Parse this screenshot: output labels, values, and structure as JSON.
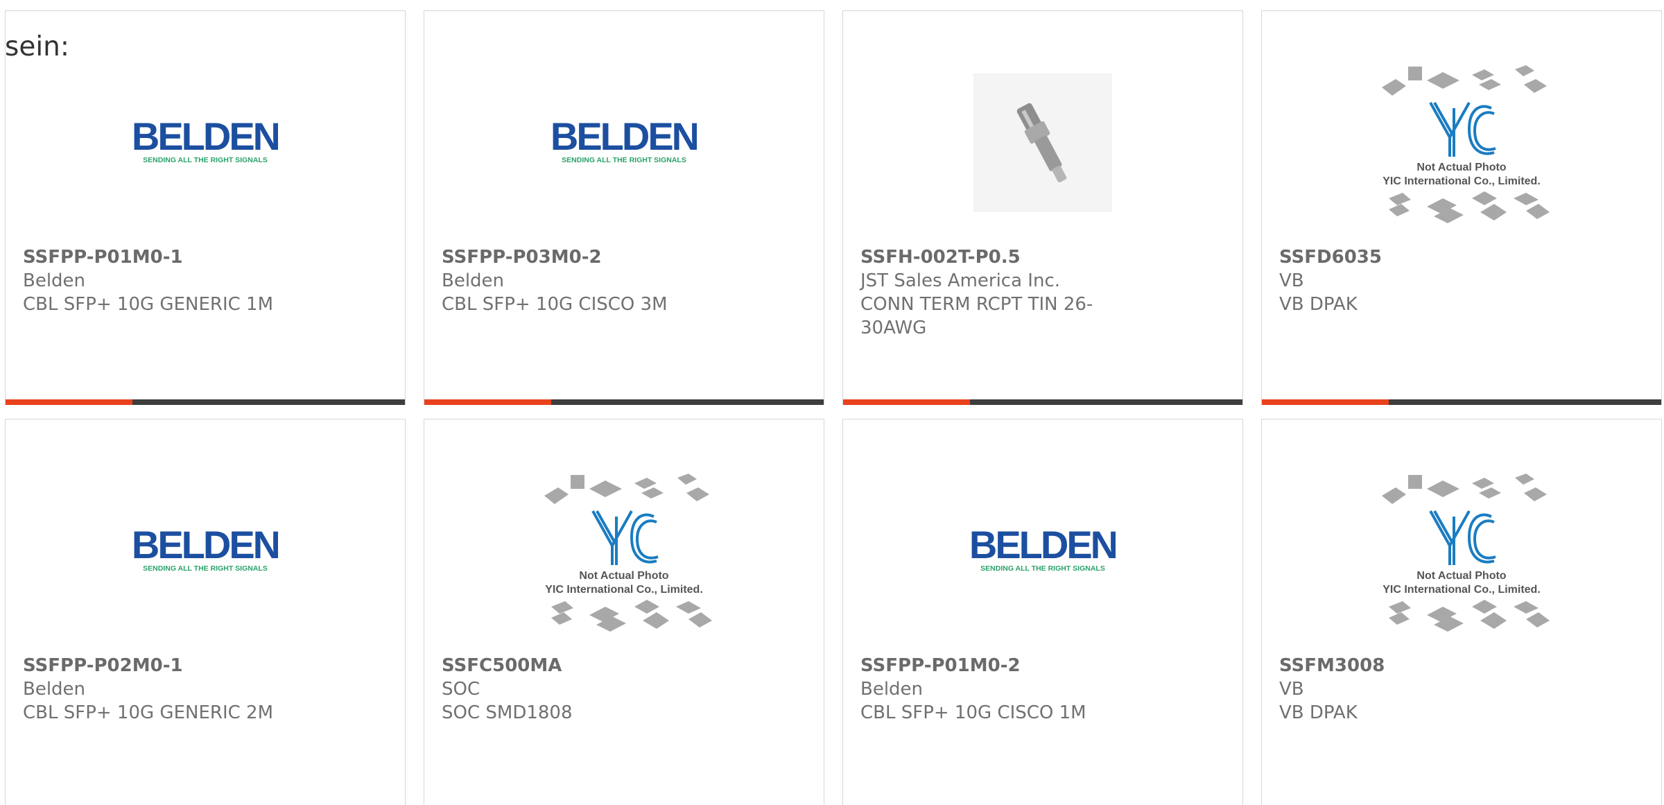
{
  "intro": "sein:",
  "colors": {
    "accent": "#e8421d",
    "bar": "#3e3e3e",
    "belden_blue": "#1c4fa0",
    "belden_green": "#2aa26a"
  },
  "logos": {
    "belden": {
      "name": "BELDEN",
      "tagline": "SENDING ALL THE RIGHT SIGNALS"
    },
    "yic": {
      "name": "YIC",
      "line1": "Not Actual Photo",
      "line2": "YIC International Co., Limited."
    }
  },
  "products": [
    {
      "part": "SSFPP-P01M0-1",
      "mfr": "Belden",
      "desc": "CBL SFP+ 10G GENERIC 1M",
      "image": "belden-logo"
    },
    {
      "part": "SSFPP-P03M0-2",
      "mfr": "Belden",
      "desc": "CBL SFP+ 10G CISCO 3M",
      "image": "belden-logo"
    },
    {
      "part": "SSFH-002T-P0.5",
      "mfr": "JST Sales America Inc.",
      "desc": "CONN TERM RCPT TIN 26-30AWG",
      "image": "crimp-terminal-photo"
    },
    {
      "part": "SSFD6035",
      "mfr": "VB",
      "desc": "VB DPAK",
      "image": "yic-placeholder"
    },
    {
      "part": "SSFPP-P02M0-1",
      "mfr": "Belden",
      "desc": "CBL SFP+ 10G GENERIC 2M",
      "image": "belden-logo"
    },
    {
      "part": "SSFC500MA",
      "mfr": "SOC",
      "desc": "SOC SMD1808",
      "image": "yic-placeholder"
    },
    {
      "part": "SSFPP-P01M0-2",
      "mfr": "Belden",
      "desc": "CBL SFP+ 10G CISCO 1M",
      "image": "belden-logo"
    },
    {
      "part": "SSFM3008",
      "mfr": "VB",
      "desc": "VB DPAK",
      "image": "yic-placeholder"
    }
  ]
}
